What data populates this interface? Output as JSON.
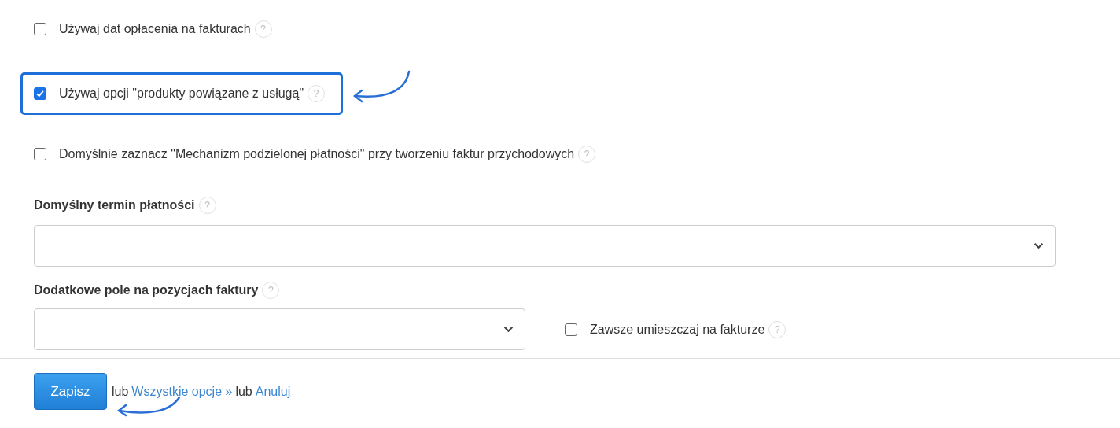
{
  "options": [
    {
      "kind": "checkbox",
      "label": "Używaj dat opłacenia na fakturach",
      "help": "?",
      "checked": false,
      "highlighted": false
    },
    {
      "kind": "checkbox",
      "label": "Używaj opcji \"produkty powiązane z usługą\"",
      "help": "?",
      "checked": true,
      "highlighted": true
    },
    {
      "kind": "checkbox",
      "label": "Domyślnie zaznacz \"Mechanizm podzielonej płatności\" przy tworzeniu faktur przychodowych",
      "help": "?",
      "checked": false,
      "highlighted": false
    },
    {
      "kind": "select",
      "label": "Domyślny termin płatności",
      "help": "?"
    },
    {
      "kind": "select_with_checkbox",
      "label": "Dodatkowe pole na pozycjach faktury",
      "help": "?",
      "checkbox": {
        "label": "Zawsze umieszczaj na fakturze",
        "help": "?",
        "checked": false
      }
    }
  ],
  "footer": {
    "save_button": {
      "label": "Zapisz",
      "annotated": true
    },
    "parts": [
      {
        "kind": "text",
        "text": "lub"
      },
      {
        "kind": "link",
        "text": "Wszystkie opcje »"
      },
      {
        "kind": "text",
        "text": "lub"
      },
      {
        "kind": "link",
        "text": "Anuluj"
      }
    ]
  }
}
